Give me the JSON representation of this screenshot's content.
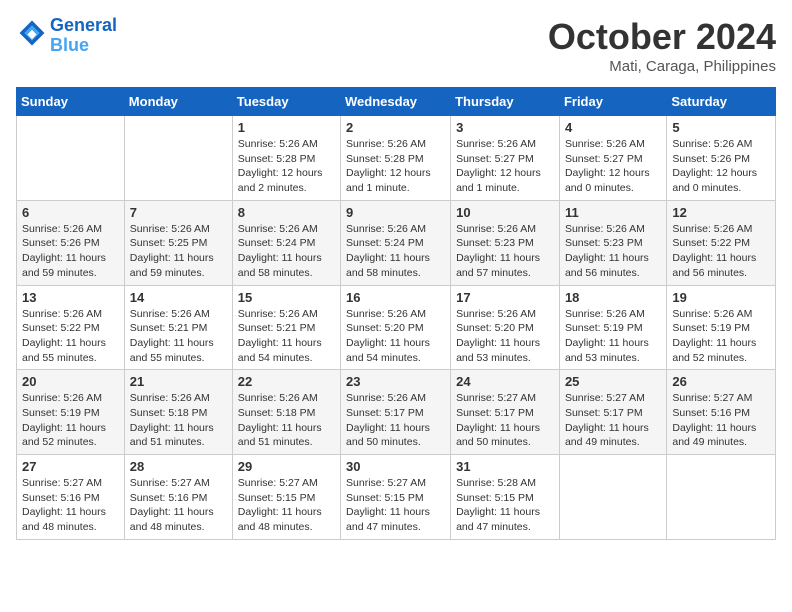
{
  "header": {
    "logo_line1": "General",
    "logo_line2": "Blue",
    "month": "October 2024",
    "location": "Mati, Caraga, Philippines"
  },
  "days_of_week": [
    "Sunday",
    "Monday",
    "Tuesday",
    "Wednesday",
    "Thursday",
    "Friday",
    "Saturday"
  ],
  "weeks": [
    [
      {
        "day": "",
        "sunrise": "",
        "sunset": "",
        "daylight": ""
      },
      {
        "day": "",
        "sunrise": "",
        "sunset": "",
        "daylight": ""
      },
      {
        "day": "1",
        "sunrise": "Sunrise: 5:26 AM",
        "sunset": "Sunset: 5:28 PM",
        "daylight": "Daylight: 12 hours and 2 minutes."
      },
      {
        "day": "2",
        "sunrise": "Sunrise: 5:26 AM",
        "sunset": "Sunset: 5:28 PM",
        "daylight": "Daylight: 12 hours and 1 minute."
      },
      {
        "day": "3",
        "sunrise": "Sunrise: 5:26 AM",
        "sunset": "Sunset: 5:27 PM",
        "daylight": "Daylight: 12 hours and 1 minute."
      },
      {
        "day": "4",
        "sunrise": "Sunrise: 5:26 AM",
        "sunset": "Sunset: 5:27 PM",
        "daylight": "Daylight: 12 hours and 0 minutes."
      },
      {
        "day": "5",
        "sunrise": "Sunrise: 5:26 AM",
        "sunset": "Sunset: 5:26 PM",
        "daylight": "Daylight: 12 hours and 0 minutes."
      }
    ],
    [
      {
        "day": "6",
        "sunrise": "Sunrise: 5:26 AM",
        "sunset": "Sunset: 5:26 PM",
        "daylight": "Daylight: 11 hours and 59 minutes."
      },
      {
        "day": "7",
        "sunrise": "Sunrise: 5:26 AM",
        "sunset": "Sunset: 5:25 PM",
        "daylight": "Daylight: 11 hours and 59 minutes."
      },
      {
        "day": "8",
        "sunrise": "Sunrise: 5:26 AM",
        "sunset": "Sunset: 5:24 PM",
        "daylight": "Daylight: 11 hours and 58 minutes."
      },
      {
        "day": "9",
        "sunrise": "Sunrise: 5:26 AM",
        "sunset": "Sunset: 5:24 PM",
        "daylight": "Daylight: 11 hours and 58 minutes."
      },
      {
        "day": "10",
        "sunrise": "Sunrise: 5:26 AM",
        "sunset": "Sunset: 5:23 PM",
        "daylight": "Daylight: 11 hours and 57 minutes."
      },
      {
        "day": "11",
        "sunrise": "Sunrise: 5:26 AM",
        "sunset": "Sunset: 5:23 PM",
        "daylight": "Daylight: 11 hours and 56 minutes."
      },
      {
        "day": "12",
        "sunrise": "Sunrise: 5:26 AM",
        "sunset": "Sunset: 5:22 PM",
        "daylight": "Daylight: 11 hours and 56 minutes."
      }
    ],
    [
      {
        "day": "13",
        "sunrise": "Sunrise: 5:26 AM",
        "sunset": "Sunset: 5:22 PM",
        "daylight": "Daylight: 11 hours and 55 minutes."
      },
      {
        "day": "14",
        "sunrise": "Sunrise: 5:26 AM",
        "sunset": "Sunset: 5:21 PM",
        "daylight": "Daylight: 11 hours and 55 minutes."
      },
      {
        "day": "15",
        "sunrise": "Sunrise: 5:26 AM",
        "sunset": "Sunset: 5:21 PM",
        "daylight": "Daylight: 11 hours and 54 minutes."
      },
      {
        "day": "16",
        "sunrise": "Sunrise: 5:26 AM",
        "sunset": "Sunset: 5:20 PM",
        "daylight": "Daylight: 11 hours and 54 minutes."
      },
      {
        "day": "17",
        "sunrise": "Sunrise: 5:26 AM",
        "sunset": "Sunset: 5:20 PM",
        "daylight": "Daylight: 11 hours and 53 minutes."
      },
      {
        "day": "18",
        "sunrise": "Sunrise: 5:26 AM",
        "sunset": "Sunset: 5:19 PM",
        "daylight": "Daylight: 11 hours and 53 minutes."
      },
      {
        "day": "19",
        "sunrise": "Sunrise: 5:26 AM",
        "sunset": "Sunset: 5:19 PM",
        "daylight": "Daylight: 11 hours and 52 minutes."
      }
    ],
    [
      {
        "day": "20",
        "sunrise": "Sunrise: 5:26 AM",
        "sunset": "Sunset: 5:19 PM",
        "daylight": "Daylight: 11 hours and 52 minutes."
      },
      {
        "day": "21",
        "sunrise": "Sunrise: 5:26 AM",
        "sunset": "Sunset: 5:18 PM",
        "daylight": "Daylight: 11 hours and 51 minutes."
      },
      {
        "day": "22",
        "sunrise": "Sunrise: 5:26 AM",
        "sunset": "Sunset: 5:18 PM",
        "daylight": "Daylight: 11 hours and 51 minutes."
      },
      {
        "day": "23",
        "sunrise": "Sunrise: 5:26 AM",
        "sunset": "Sunset: 5:17 PM",
        "daylight": "Daylight: 11 hours and 50 minutes."
      },
      {
        "day": "24",
        "sunrise": "Sunrise: 5:27 AM",
        "sunset": "Sunset: 5:17 PM",
        "daylight": "Daylight: 11 hours and 50 minutes."
      },
      {
        "day": "25",
        "sunrise": "Sunrise: 5:27 AM",
        "sunset": "Sunset: 5:17 PM",
        "daylight": "Daylight: 11 hours and 49 minutes."
      },
      {
        "day": "26",
        "sunrise": "Sunrise: 5:27 AM",
        "sunset": "Sunset: 5:16 PM",
        "daylight": "Daylight: 11 hours and 49 minutes."
      }
    ],
    [
      {
        "day": "27",
        "sunrise": "Sunrise: 5:27 AM",
        "sunset": "Sunset: 5:16 PM",
        "daylight": "Daylight: 11 hours and 48 minutes."
      },
      {
        "day": "28",
        "sunrise": "Sunrise: 5:27 AM",
        "sunset": "Sunset: 5:16 PM",
        "daylight": "Daylight: 11 hours and 48 minutes."
      },
      {
        "day": "29",
        "sunrise": "Sunrise: 5:27 AM",
        "sunset": "Sunset: 5:15 PM",
        "daylight": "Daylight: 11 hours and 48 minutes."
      },
      {
        "day": "30",
        "sunrise": "Sunrise: 5:27 AM",
        "sunset": "Sunset: 5:15 PM",
        "daylight": "Daylight: 11 hours and 47 minutes."
      },
      {
        "day": "31",
        "sunrise": "Sunrise: 5:28 AM",
        "sunset": "Sunset: 5:15 PM",
        "daylight": "Daylight: 11 hours and 47 minutes."
      },
      {
        "day": "",
        "sunrise": "",
        "sunset": "",
        "daylight": ""
      },
      {
        "day": "",
        "sunrise": "",
        "sunset": "",
        "daylight": ""
      }
    ]
  ]
}
